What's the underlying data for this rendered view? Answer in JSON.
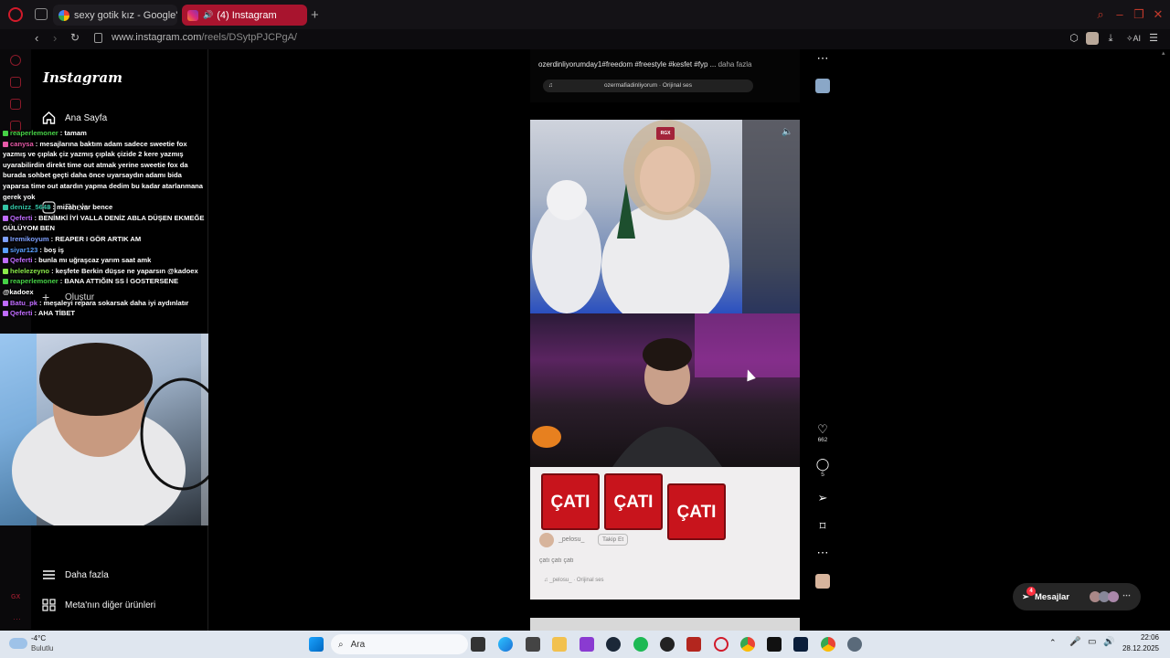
{
  "browser": {
    "tabs": [
      {
        "label": "sexy gotik kız - Google'da",
        "active": false
      },
      {
        "label": "(4) Instagram",
        "active": true
      }
    ],
    "url_host": "www.instagram.com",
    "url_path": "/reels/DSytpPJCPgA/",
    "ai_label": "AI"
  },
  "instagram": {
    "logo": "Instagram",
    "nav": {
      "home": "Ana Sayfa",
      "reels": "Reels",
      "create": "Oluştur",
      "more": "Daha fazla",
      "meta": "Meta'nın diğer ürünleri"
    },
    "reel_top": {
      "caption": "ozerdinliyorumday1#freedom #freestyle #kesfet #fyp ...",
      "more": "daha fazla",
      "audio": "ozermafiadinliyorum · Orijinal ses"
    },
    "reel_main": {
      "rgx_badge": "RGX",
      "cati_words": [
        "ÇATI",
        "ÇATI",
        "ÇATI"
      ],
      "author": "_pelosu_",
      "follow": "Takip Et",
      "caption": "çatı çatı çatı",
      "audio": "_pelosu_ · Orijinal ses"
    },
    "actions": {
      "likes": "662",
      "comments": "5"
    },
    "messages": {
      "label": "Mesajlar",
      "count": "4"
    }
  },
  "chat": [
    {
      "user": "reaperlemoner",
      "text": ": tamam",
      "color": "#46d246"
    },
    {
      "user": "canysa",
      "text": ": mesajlarına baktım adam sadece sweetie fox yazmış ve çıplak çiz yazmış çıplak çizide 2 kere yazmış uyarabilirdin direkt time out atmak yerine sweetie fox da burada sohbet geçti daha önce uyarsaydın adamı bida yaparsa time out atardın yapma dedim bu kadar atarlanmana gerek yok",
      "color": "#e75aa8"
    },
    {
      "user": "denizz_5648",
      "text": ": mizahı var bence",
      "color": "#34c4a6"
    },
    {
      "user": "Qeferti",
      "text": ": BENİMKİ İYİ VALLA DENİZ ABLA DÜŞEN EKMEĞE GÜLÜYOM BEN",
      "color": "#c06cff"
    },
    {
      "user": "Iremikoyum",
      "text": ": REAPER I GÖR ARTIK AM",
      "color": "#7fa0ff"
    },
    {
      "user": "siyar123",
      "text": ": boş iş",
      "color": "#5aa0ff"
    },
    {
      "user": "Qeferti",
      "text": ": bunla mı uğraşcaz yarım saat amk",
      "color": "#c06cff"
    },
    {
      "user": "helelezeyno",
      "text": ": keşfete Berkin düşse ne yaparsın @kadoex",
      "color": "#8bea4a"
    },
    {
      "user": "reaperlemoner",
      "text": ": BANA ATTIĞIN SS İ GOSTERSENE @kadoex",
      "color": "#46d246"
    },
    {
      "user": "Batu_pk",
      "text": ": meşaleyi repara sokarsak daha iyi aydınlatır",
      "color": "#c06cff"
    },
    {
      "user": "Qeferti",
      "text": ": AHA TİBET",
      "color": "#c06cff"
    }
  ],
  "taskbar": {
    "weather_temp": "-4°C",
    "weather_desc": "Bulutlu",
    "search": "Ara",
    "time": "22:06",
    "date": "28.12.2025"
  }
}
